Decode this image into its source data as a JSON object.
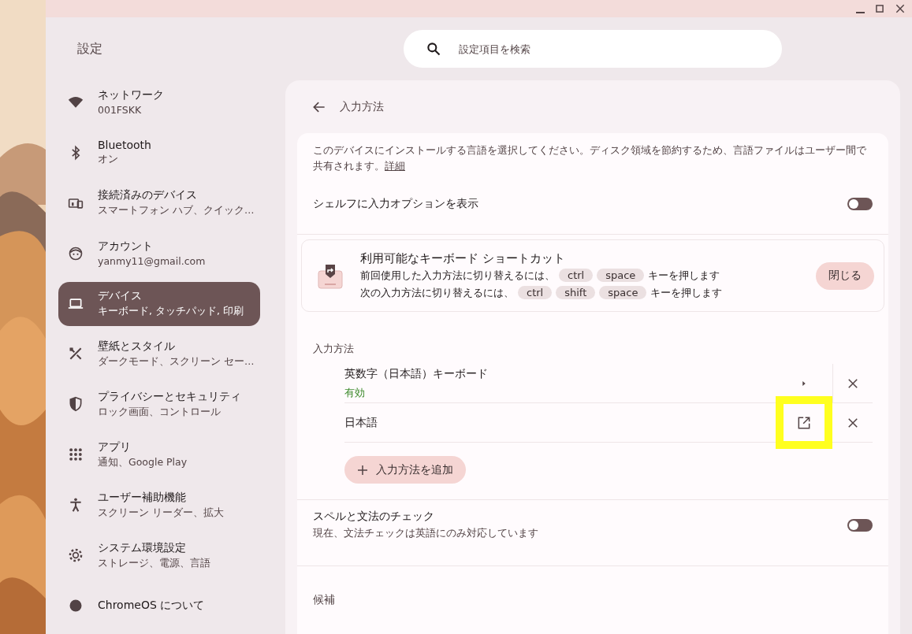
{
  "window": {
    "title": "設定"
  },
  "search": {
    "placeholder": "設定項目を検索"
  },
  "sidebar": {
    "items": [
      {
        "label": "ネットワーク",
        "sublabel": "001FSKK",
        "selected": false
      },
      {
        "label": "Bluetooth",
        "sublabel": "オン",
        "selected": false
      },
      {
        "label": "接続済みのデバイス",
        "sublabel": "スマートフォン ハブ、クイック…",
        "selected": false
      },
      {
        "label": "アカウント",
        "sublabel": "yanmy11@gmail.com",
        "selected": false
      },
      {
        "label": "デバイス",
        "sublabel": "キーボード, タッチパッド, 印刷",
        "selected": true
      },
      {
        "label": "壁紙とスタイル",
        "sublabel": "ダークモード、スクリーン セー…",
        "selected": false
      },
      {
        "label": "プライバシーとセキュリティ",
        "sublabel": "ロック画面、コントロール",
        "selected": false
      },
      {
        "label": "アプリ",
        "sublabel": "通知、Google Play",
        "selected": false
      },
      {
        "label": "ユーザー補助機能",
        "sublabel": "スクリーン リーダー、拡大",
        "selected": false
      },
      {
        "label": "システム環境設定",
        "sublabel": "ストレージ、電源、言語",
        "selected": false
      },
      {
        "label": "ChromeOS について",
        "selected": false
      }
    ]
  },
  "page": {
    "title": "入力方法",
    "description": "このデバイスにインストールする言語を選択してください。ディスク領域を節約するため、言語ファイルはユーザー間で共有されます。",
    "description_link": "詳細",
    "shelf_option": {
      "label": "シェルフに入力オプションを表示",
      "on": false
    },
    "shortcut_card": {
      "title": "利用可能なキーボード ショートカット",
      "close_button": "閉じる",
      "lines": [
        {
          "prefix": "前回使用した入力方法に切り替えるには、",
          "keys": [
            "ctrl",
            "space"
          ],
          "suffix": "キーを押します"
        },
        {
          "prefix": "次の入力方法に切り替えるには、",
          "keys": [
            "ctrl",
            "shift",
            "space"
          ],
          "suffix": "キーを押します"
        }
      ]
    },
    "input_methods": {
      "heading": "入力方法",
      "methods": [
        {
          "name": "英数字（日本語）キーボード",
          "status": "有効",
          "kind": "submenu",
          "highlighted": false
        },
        {
          "name": "日本語",
          "kind": "external",
          "highlighted": true
        }
      ],
      "add_button": "入力方法を追加"
    },
    "spell_check": {
      "label": "スペルと文法のチェック",
      "description": "現在、文法チェックは英語にのみ対応しています",
      "on": false
    },
    "suggestions": {
      "heading": "候補"
    }
  }
}
